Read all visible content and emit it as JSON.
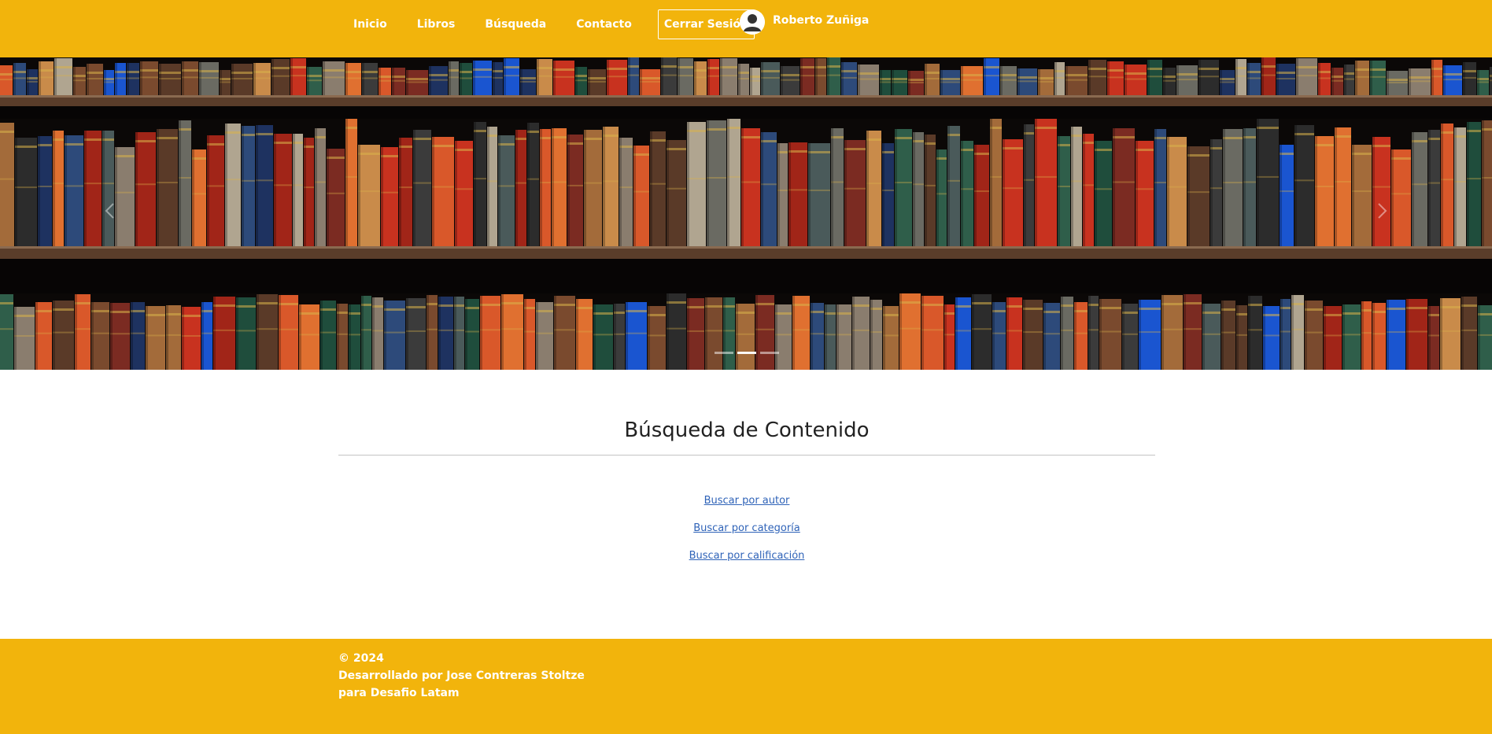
{
  "nav": {
    "links": [
      "Inicio",
      "Libros",
      "Búsqueda",
      "Contacto"
    ],
    "logout_label": "Cerrar Sesión",
    "user_name": "Roberto Zuñiga",
    "brand_color": "#f2b40c"
  },
  "carousel": {
    "slides_count": 3,
    "active_index": 1,
    "prev_icon": "chevron-left-icon",
    "next_icon": "chevron-right-icon"
  },
  "main": {
    "title": "Búsqueda de Contenido",
    "links": [
      "Buscar por autor",
      "Buscar por categoría",
      "Buscar por calificación"
    ],
    "link_color": "#2f63b8"
  },
  "footer": {
    "line1": "© 2024",
    "line2": "Desarrollado por Jose Contreras Stoltze",
    "line3": "para Desafio Latam"
  }
}
